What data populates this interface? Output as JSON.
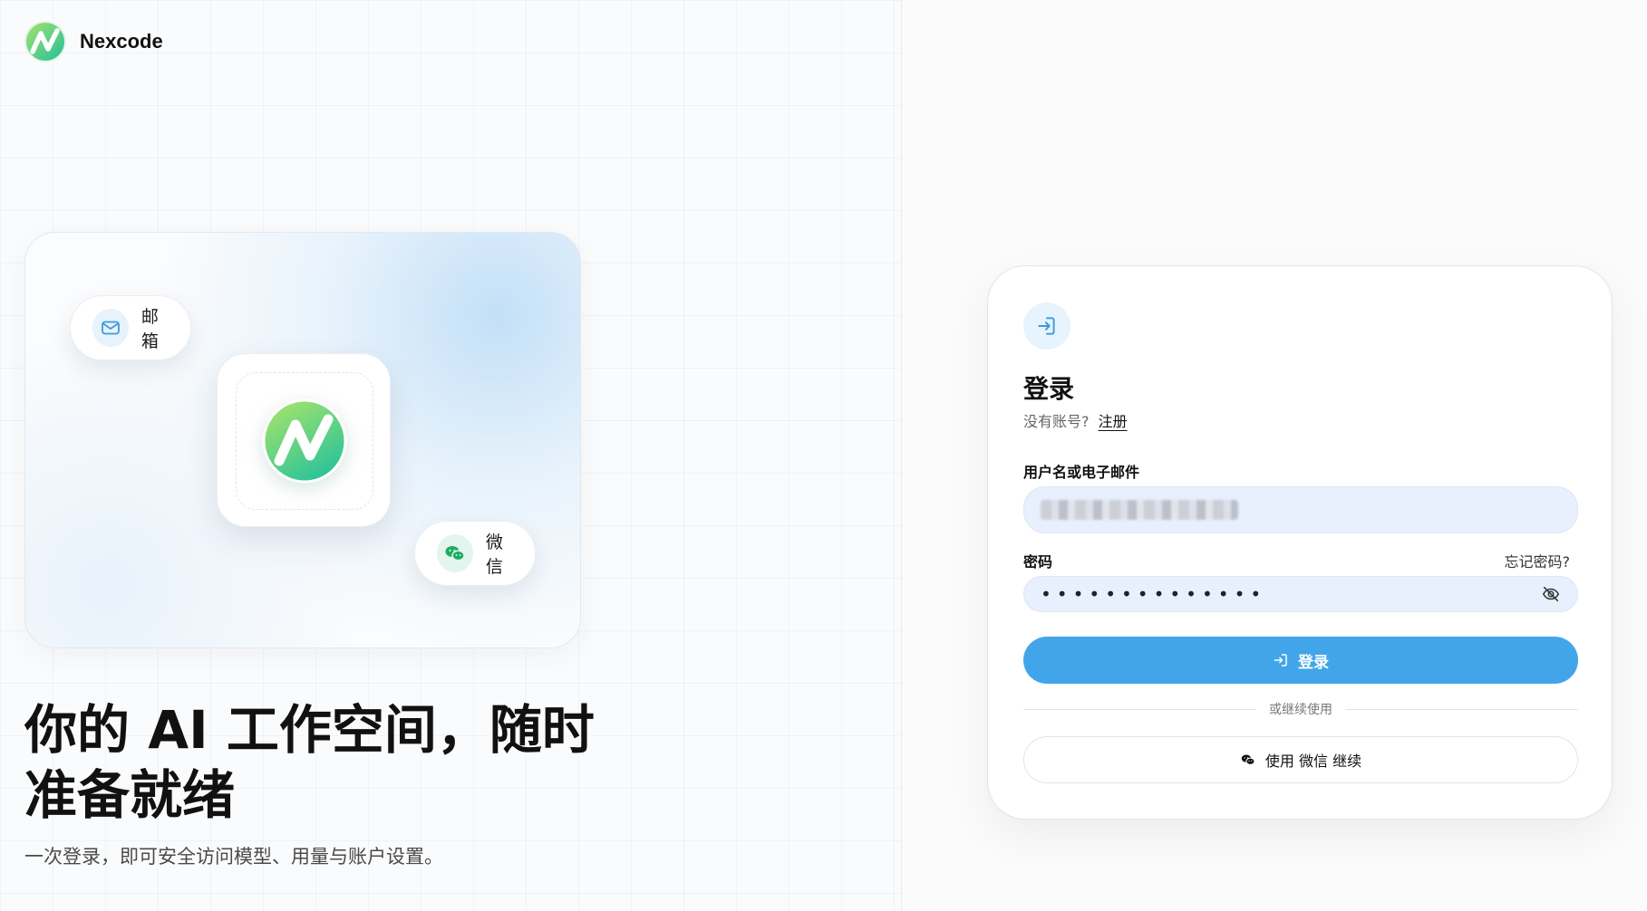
{
  "brand": {
    "name": "Nexcode"
  },
  "hero": {
    "email_pill": "邮箱",
    "wechat_pill": "微信",
    "headline_line1": "你的 AI 工作空间，随时",
    "headline_line2": "准备就绪",
    "subline": "一次登录，即可安全访问模型、用量与账户设置。"
  },
  "login": {
    "title": "登录",
    "no_account": "没有账号?",
    "signup_link": "注册",
    "username_label": "用户名或电子邮件",
    "password_label": "密码",
    "forgot_password": "忘记密码?",
    "password_mask": "••••••••••••••",
    "submit_label": "登录",
    "divider_text": "或继续使用",
    "wechat_continue": "使用 微信 继续"
  },
  "colors": {
    "accent_blue": "#42a5ea",
    "input_bg": "#e8effd",
    "logo_green_start": "#9ee26a",
    "logo_green_end": "#22c29a",
    "wechat_green": "#1aad61"
  },
  "icons": [
    "nexcode-logo-icon",
    "mail-icon",
    "wechat-icon",
    "login-door-icon",
    "eye-off-icon",
    "login-arrow-icon"
  ]
}
